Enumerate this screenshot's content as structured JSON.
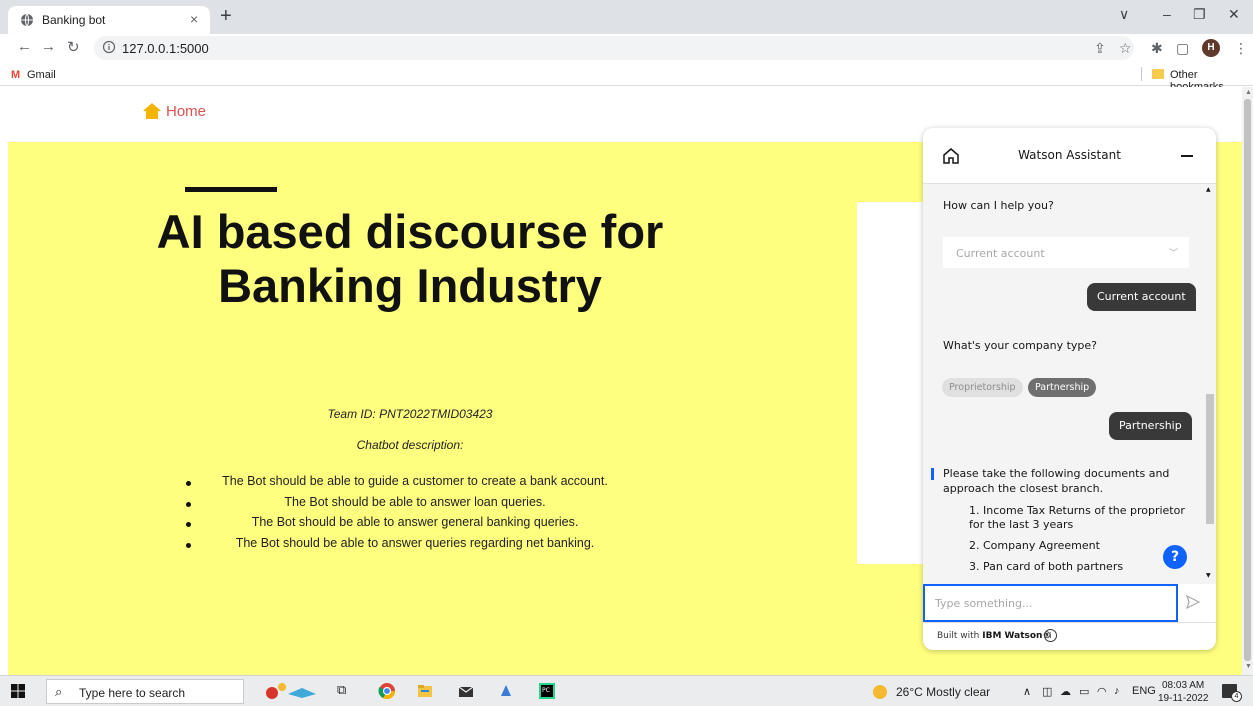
{
  "browser": {
    "tab_title": "Banking bot",
    "tab_close": "×",
    "new_tab": "+",
    "url": "127.0.0.1:5000",
    "window_controls": [
      "∨",
      "–",
      "❐",
      "✕"
    ],
    "bookmarks": {
      "gmail": "Gmail",
      "other": "Other bookmarks"
    },
    "profile_initial": "H"
  },
  "page": {
    "nav": {
      "home_label": "Home"
    },
    "hero": {
      "title": "AI based discourse for Banking Industry",
      "team_id": "Team ID: PNT2022TMID03423",
      "description_label": "Chatbot description:",
      "points": [
        "The Bot should be able to guide a customer to create a bank account.",
        "The Bot should be able to answer loan queries.",
        "The Bot should be able to answer general banking queries.",
        "The Bot should be able to answer queries regarding net banking."
      ]
    }
  },
  "watson": {
    "title": "Watson Assistant",
    "greeting": "How can I help you?",
    "dropdown_value": "Current account",
    "user_reply_1": "Current account",
    "question": "What's your company type?",
    "options": [
      "Proprietorship",
      "Partnership"
    ],
    "user_reply_2": "Partnership",
    "doc_intro": "Please take the following documents and approach the closest branch.",
    "documents": [
      "1. Income Tax Returns of the proprietor for the last 3 years",
      "2. Company Agreement",
      "3. Pan card of both partners"
    ],
    "help_icon": "?",
    "input_placeholder": "Type something...",
    "footer_prefix": "Built with ",
    "footer_brand": "IBM Watson®",
    "accent_color": "#0f62fe"
  },
  "taskbar": {
    "search_placeholder": "Type here to search",
    "weather": "26°C  Mostly clear",
    "language": "ENG",
    "time": "08:03 AM",
    "date": "19-11-2022",
    "notification_count": "4"
  }
}
